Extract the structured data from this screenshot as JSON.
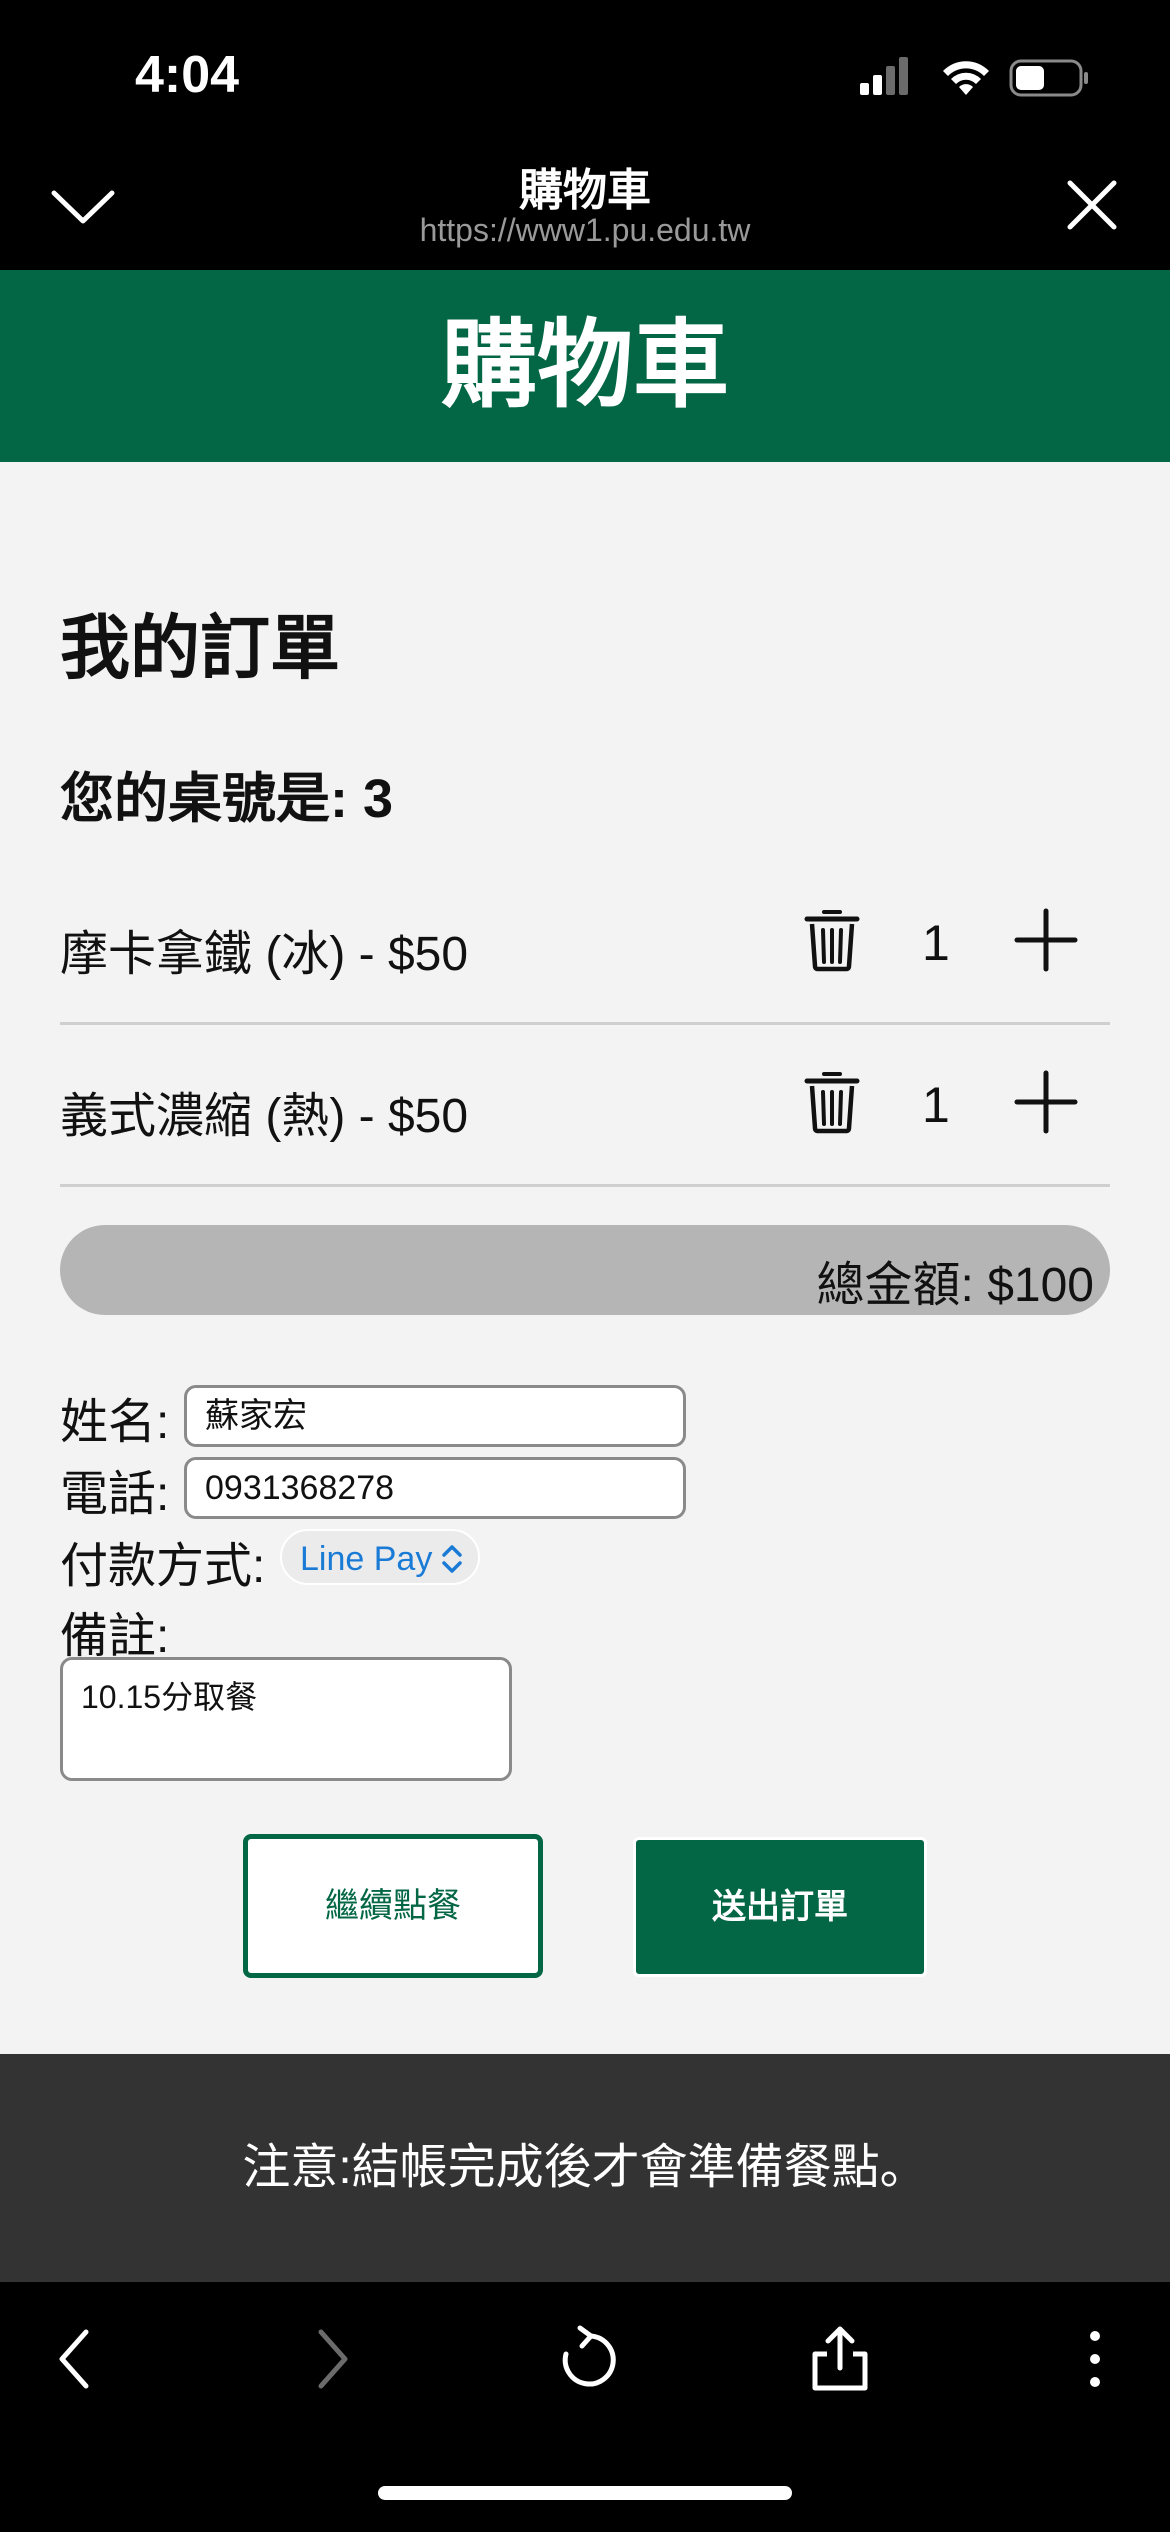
{
  "status_bar": {
    "time": "4:04"
  },
  "browser": {
    "title": "購物車",
    "url": "https://www1.pu.edu.tw"
  },
  "banner": {
    "title": "購物車"
  },
  "order": {
    "heading": "我的訂單",
    "table_label": "您的桌號是: 3",
    "items": [
      {
        "name": "摩卡拿鐵 (冰) - $50",
        "qty": "1"
      },
      {
        "name": "義式濃縮 (熱) - $50",
        "qty": "1"
      }
    ],
    "total": "總金額: $100"
  },
  "form": {
    "name_label": "姓名:",
    "name_value": "蘇家宏",
    "phone_label": "電話:",
    "phone_value": "0931368278",
    "payment_label": "付款方式:",
    "payment_value": "Line Pay",
    "notes_label": "備註:",
    "notes_value": "10.15分取餐"
  },
  "buttons": {
    "continue": "繼續點餐",
    "submit": "送出訂單"
  },
  "notice": "注意:結帳完成後才會準備餐點。",
  "colors": {
    "brand_green": "#036645",
    "notice_bg": "#333333",
    "total_bar": "#b5b5b5",
    "select_text": "#1a7bd6"
  }
}
